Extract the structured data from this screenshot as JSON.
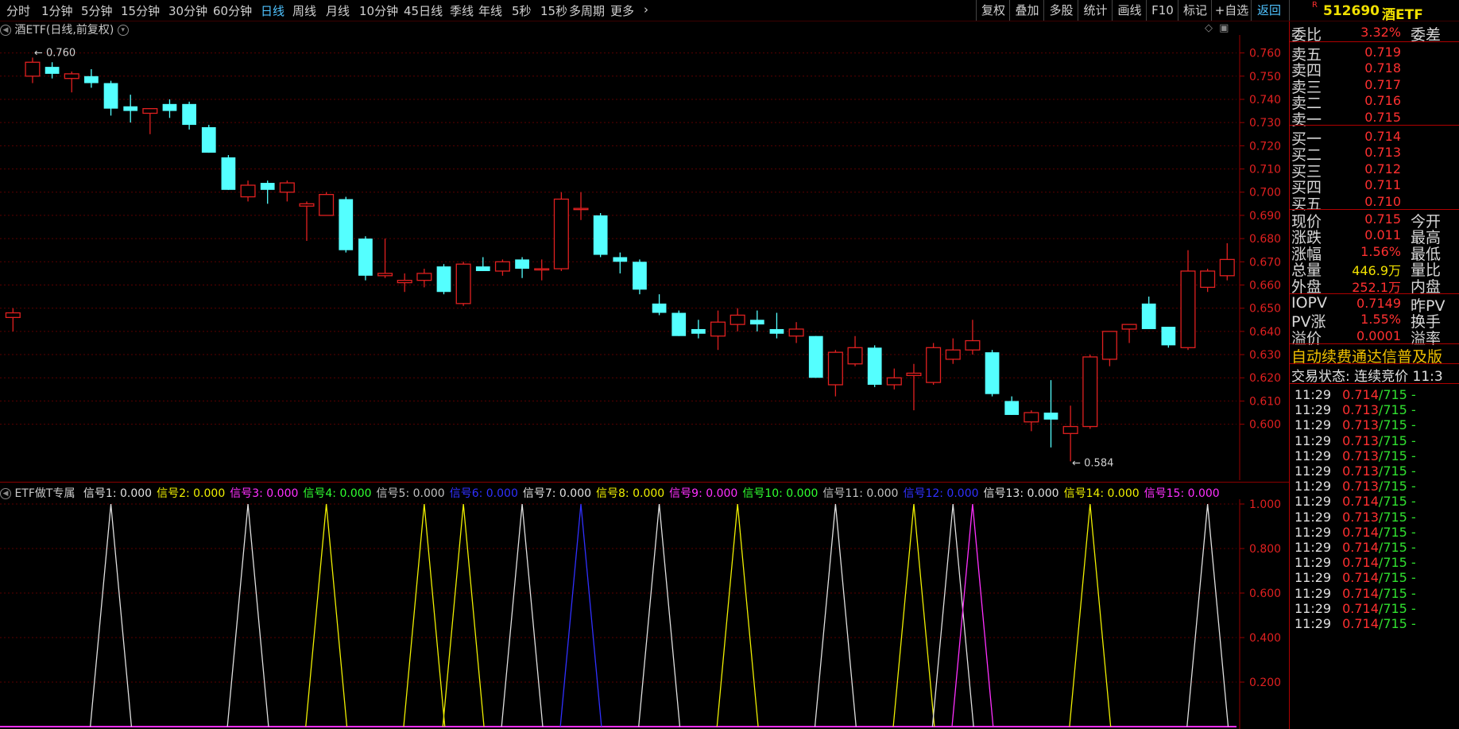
{
  "toolbar": {
    "periods": [
      "分时",
      "1分钟",
      "5分钟",
      "15分钟",
      "30分钟",
      "60分钟",
      "日线",
      "周线",
      "月线",
      "10分钟",
      "45日线",
      "季线",
      "年线",
      "5秒",
      "15秒",
      "多周期",
      "更多"
    ],
    "active_period": "日线",
    "right_buttons": [
      "复权",
      "叠加",
      "多股",
      "统计",
      "画线",
      "F10",
      "标记",
      "+自选",
      "返回"
    ]
  },
  "stock": {
    "badge": "R",
    "code": "512690",
    "name": "酒ETF"
  },
  "main_chart": {
    "title": "酒ETF(日线,前复权)",
    "high_label": "0.760",
    "low_label": "0.584",
    "y_ticks": [
      "0.760",
      "0.750",
      "0.740",
      "0.730",
      "0.720",
      "0.710",
      "0.700",
      "0.690",
      "0.680",
      "0.670",
      "0.660",
      "0.650",
      "0.640",
      "0.630",
      "0.620",
      "0.610",
      "0.600"
    ],
    "up_color": "#e02020",
    "down_color": "#54ffff"
  },
  "chart_data": {
    "type": "candlestick",
    "y_range": [
      0.58,
      0.765
    ],
    "candles": [
      [
        0.646,
        0.65,
        0.64,
        0.648
      ],
      [
        0.75,
        0.758,
        0.747,
        0.756
      ],
      [
        0.754,
        0.756,
        0.749,
        0.751
      ],
      [
        0.749,
        0.752,
        0.743,
        0.751
      ],
      [
        0.75,
        0.753,
        0.745,
        0.747
      ],
      [
        0.747,
        0.748,
        0.733,
        0.736
      ],
      [
        0.737,
        0.742,
        0.73,
        0.735
      ],
      [
        0.734,
        0.736,
        0.725,
        0.736
      ],
      [
        0.738,
        0.74,
        0.732,
        0.735
      ],
      [
        0.738,
        0.739,
        0.727,
        0.729
      ],
      [
        0.728,
        0.729,
        0.717,
        0.717
      ],
      [
        0.715,
        0.716,
        0.701,
        0.701
      ],
      [
        0.698,
        0.705,
        0.696,
        0.703
      ],
      [
        0.704,
        0.705,
        0.695,
        0.701
      ],
      [
        0.7,
        0.705,
        0.696,
        0.704
      ],
      [
        0.694,
        0.696,
        0.679,
        0.695
      ],
      [
        0.69,
        0.7,
        0.69,
        0.699
      ],
      [
        0.697,
        0.698,
        0.674,
        0.675
      ],
      [
        0.68,
        0.681,
        0.662,
        0.664
      ],
      [
        0.664,
        0.68,
        0.663,
        0.665
      ],
      [
        0.661,
        0.665,
        0.657,
        0.662
      ],
      [
        0.662,
        0.667,
        0.659,
        0.665
      ],
      [
        0.668,
        0.669,
        0.656,
        0.657
      ],
      [
        0.652,
        0.67,
        0.651,
        0.669
      ],
      [
        0.668,
        0.672,
        0.666,
        0.666
      ],
      [
        0.666,
        0.671,
        0.664,
        0.67
      ],
      [
        0.671,
        0.672,
        0.663,
        0.667
      ],
      [
        0.667,
        0.671,
        0.662,
        0.667
      ],
      [
        0.667,
        0.7,
        0.666,
        0.697
      ],
      [
        0.693,
        0.7,
        0.688,
        0.693
      ],
      [
        0.69,
        0.691,
        0.672,
        0.673
      ],
      [
        0.672,
        0.674,
        0.665,
        0.67
      ],
      [
        0.67,
        0.671,
        0.656,
        0.658
      ],
      [
        0.652,
        0.656,
        0.647,
        0.648
      ],
      [
        0.648,
        0.649,
        0.638,
        0.638
      ],
      [
        0.641,
        0.645,
        0.637,
        0.639
      ],
      [
        0.638,
        0.649,
        0.632,
        0.644
      ],
      [
        0.643,
        0.65,
        0.64,
        0.647
      ],
      [
        0.645,
        0.649,
        0.64,
        0.643
      ],
      [
        0.641,
        0.648,
        0.637,
        0.639
      ],
      [
        0.638,
        0.644,
        0.635,
        0.641
      ],
      [
        0.638,
        0.638,
        0.62,
        0.62
      ],
      [
        0.617,
        0.632,
        0.612,
        0.631
      ],
      [
        0.626,
        0.638,
        0.625,
        0.633
      ],
      [
        0.633,
        0.634,
        0.616,
        0.617
      ],
      [
        0.617,
        0.624,
        0.615,
        0.62
      ],
      [
        0.621,
        0.626,
        0.606,
        0.622
      ],
      [
        0.618,
        0.635,
        0.617,
        0.633
      ],
      [
        0.628,
        0.637,
        0.626,
        0.632
      ],
      [
        0.632,
        0.645,
        0.63,
        0.636
      ],
      [
        0.631,
        0.632,
        0.612,
        0.613
      ],
      [
        0.61,
        0.612,
        0.604,
        0.604
      ],
      [
        0.601,
        0.606,
        0.597,
        0.605
      ],
      [
        0.605,
        0.619,
        0.59,
        0.602
      ],
      [
        0.596,
        0.608,
        0.584,
        0.599
      ],
      [
        0.599,
        0.63,
        0.598,
        0.629
      ],
      [
        0.628,
        0.64,
        0.625,
        0.64
      ],
      [
        0.641,
        0.643,
        0.635,
        0.643
      ],
      [
        0.652,
        0.655,
        0.641,
        0.641
      ],
      [
        0.642,
        0.642,
        0.633,
        0.634
      ],
      [
        0.633,
        0.675,
        0.632,
        0.666
      ],
      [
        0.659,
        0.667,
        0.657,
        0.666
      ],
      [
        0.664,
        0.678,
        0.662,
        0.671
      ]
    ]
  },
  "indicator": {
    "title": "ETF做T专属",
    "signals": [
      {
        "name": "信号1: 0.000",
        "color": "#e0e0e0"
      },
      {
        "name": "信号2: 0.000",
        "color": "#f0f000"
      },
      {
        "name": "信号3: 0.000",
        "color": "#ff30ff"
      },
      {
        "name": "信号4: 0.000",
        "color": "#30ff30"
      },
      {
        "name": "信号5: 0.000",
        "color": "#c0c0c0"
      },
      {
        "name": "信号6: 0.000",
        "color": "#3030ff"
      },
      {
        "name": "信号7: 0.000",
        "color": "#e0e0e0"
      },
      {
        "name": "信号8: 0.000",
        "color": "#f0f000"
      },
      {
        "name": "信号9: 0.000",
        "color": "#ff30ff"
      },
      {
        "name": "信号10: 0.000",
        "color": "#30ff30"
      },
      {
        "name": "信号11: 0.000",
        "color": "#c0c0c0"
      },
      {
        "name": "信号12: 0.000",
        "color": "#3030ff"
      },
      {
        "name": "信号13: 0.000",
        "color": "#e0e0e0"
      },
      {
        "name": "信号14: 0.000",
        "color": "#f0f000"
      },
      {
        "name": "信号15: 0.000",
        "color": "#ff30ff"
      }
    ],
    "y_ticks": [
      "1.000",
      "0.800",
      "0.600",
      "0.400",
      "0.200"
    ],
    "y_range": [
      0,
      1.0
    ],
    "spikes": [
      {
        "x": 5,
        "color": "#e0e0e0"
      },
      {
        "x": 12,
        "color": "#e0e0e0"
      },
      {
        "x": 16,
        "color": "#f0f000"
      },
      {
        "x": 21,
        "color": "#f0f000"
      },
      {
        "x": 23,
        "color": "#f0f000"
      },
      {
        "x": 26,
        "color": "#e0e0e0"
      },
      {
        "x": 29,
        "color": "#3030ff"
      },
      {
        "x": 33,
        "color": "#e0e0e0"
      },
      {
        "x": 37,
        "color": "#f0f000"
      },
      {
        "x": 42,
        "color": "#e0e0e0"
      },
      {
        "x": 46,
        "color": "#f0f000"
      },
      {
        "x": 48,
        "color": "#e0e0e0"
      },
      {
        "x": 49,
        "color": "#ff30ff"
      },
      {
        "x": 55,
        "color": "#f0f000"
      },
      {
        "x": 61,
        "color": "#e0e0e0"
      }
    ]
  },
  "panel": {
    "weibi": {
      "label": "委比",
      "value": "3.32%",
      "right": "委差"
    },
    "asks": [
      {
        "label": "卖五",
        "price": "0.719"
      },
      {
        "label": "卖四",
        "price": "0.718"
      },
      {
        "label": "卖三",
        "price": "0.717"
      },
      {
        "label": "卖二",
        "price": "0.716"
      },
      {
        "label": "卖一",
        "price": "0.715"
      }
    ],
    "bids": [
      {
        "label": "买一",
        "price": "0.714"
      },
      {
        "label": "买二",
        "price": "0.713"
      },
      {
        "label": "买三",
        "price": "0.712"
      },
      {
        "label": "买四",
        "price": "0.711"
      },
      {
        "label": "买五",
        "price": "0.710"
      }
    ],
    "quotes": [
      {
        "label": "现价",
        "value": "0.715",
        "right": "今开",
        "color": "#ff3030"
      },
      {
        "label": "涨跌",
        "value": "0.011",
        "right": "最高",
        "color": "#ff3030"
      },
      {
        "label": "涨幅",
        "value": "1.56%",
        "right": "最低",
        "color": "#ff3030"
      },
      {
        "label": "总量",
        "value": "446.9万",
        "right": "量比",
        "color": "#f0e000"
      },
      {
        "label": "外盘",
        "value": "252.1万",
        "right": "内盘",
        "color": "#ff3030"
      }
    ],
    "iopv": [
      {
        "label": "IOPV",
        "value": "0.7149",
        "right": "昨PV"
      },
      {
        "label": "PV涨",
        "value": "1.55%",
        "right": "换手"
      },
      {
        "label": "溢价",
        "value": "0.0001",
        "right": "溢率"
      }
    ],
    "notice": "自动续费通达信普及版",
    "trade_status": "交易状态: 连续竞价 11:3",
    "ticks": [
      {
        "time": "11:29",
        "price": "0.714",
        "vol": "/715 -"
      },
      {
        "time": "11:29",
        "price": "0.713",
        "vol": "/715 -"
      },
      {
        "time": "11:29",
        "price": "0.713",
        "vol": "/715 -"
      },
      {
        "time": "11:29",
        "price": "0.713",
        "vol": "/715 -"
      },
      {
        "time": "11:29",
        "price": "0.713",
        "vol": "/715 -"
      },
      {
        "time": "11:29",
        "price": "0.713",
        "vol": "/715 -"
      },
      {
        "time": "11:29",
        "price": "0.713",
        "vol": "/715 -"
      },
      {
        "time": "11:29",
        "price": "0.714",
        "vol": "/715 -"
      },
      {
        "time": "11:29",
        "price": "0.713",
        "vol": "/715 -"
      },
      {
        "time": "11:29",
        "price": "0.714",
        "vol": "/715 -"
      },
      {
        "time": "11:29",
        "price": "0.714",
        "vol": "/715 -"
      },
      {
        "time": "11:29",
        "price": "0.714",
        "vol": "/715 -"
      },
      {
        "time": "11:29",
        "price": "0.714",
        "vol": "/715 -"
      },
      {
        "time": "11:29",
        "price": "0.714",
        "vol": "/715 -"
      },
      {
        "time": "11:29",
        "price": "0.714",
        "vol": "/715 -"
      },
      {
        "time": "11:29",
        "price": "0.714",
        "vol": "/715 -"
      }
    ]
  }
}
